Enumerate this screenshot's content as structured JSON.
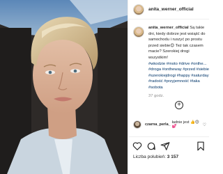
{
  "post": {
    "username": "anita_werner_official",
    "caption_username": "anita_werner_official",
    "caption_text": "Są takie dni, kiedy dobrze jest wsiąść do samochodu i ruszyć po prostu przed siebie😊 Też tak czasem macie? Szerokiej drogi wszystkim!",
    "hashtags": "#wkodzie #moto #drive #onthe... #droga #ontheway #przed #siebie #szerokiejdrogi #happy #saturday #radość #przyjemność #taka #sobota",
    "time": "37 godz.",
    "load_more_icon": "plus-circle-icon"
  },
  "comment": {
    "username": "czarna_perla_",
    "text": "ładnie jest 👍😊💕",
    "heart_icon": "heart-icon"
  },
  "actions": {
    "like_icon": "heart-icon",
    "comment_icon": "comment-icon",
    "share_icon": "share-icon",
    "save_icon": "bookmark-icon"
  },
  "likes": {
    "label": "Liczba polubień:",
    "count": "3 157"
  },
  "colors": {
    "text": "#262626",
    "muted": "#8e8e8e",
    "hashtag": "#003569",
    "border": "#efefef"
  }
}
